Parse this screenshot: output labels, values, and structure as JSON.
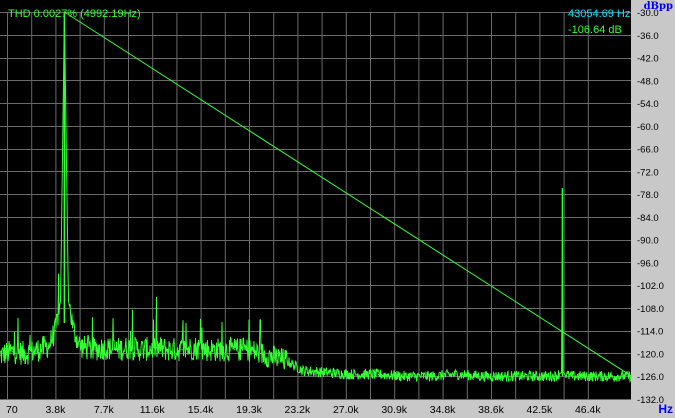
{
  "readouts": {
    "thd": "THD 0.0027% (4992.19Hz)",
    "cursor_frequency": "43054.69 Hz",
    "cursor_level": "-106.64 dB"
  },
  "colors": {
    "background": "#000000",
    "grid": "#6a6a6a",
    "trace": "#33ff33",
    "panel": "#c8c8c8",
    "unit_label": "#0000ff"
  },
  "chart_data": {
    "type": "line",
    "xlabel": "Hz",
    "ylabel": "dBpp",
    "x_tick_labels": [
      "70",
      "3.8k",
      "7.7k",
      "11.6k",
      "15.4k",
      "19.3k",
      "23.2k",
      "27.0k",
      "30.9k",
      "34.8k",
      "38.6k",
      "42.5k",
      "46.4k"
    ],
    "y_tick_labels": [
      "-30.0",
      "-36.0",
      "-42.0",
      "-48.0",
      "-54.0",
      "-60.0",
      "-66.0",
      "-72.0",
      "-78.0",
      "-84.0",
      "-90.0",
      "-96.0",
      "-102.0",
      "-108.0",
      "-114.0",
      "-120.0",
      "-126.0",
      "-132.0"
    ],
    "xlim": [
      70,
      48300
    ],
    "ylim": [
      -132,
      -30
    ],
    "grid": true,
    "series": [
      {
        "color": "#33ff33",
        "x": [
          70,
          1000,
          2000,
          3000,
          3800,
          4300,
          4700,
          4992,
          5300,
          5700,
          6200,
          7000,
          8000,
          9000,
          10000,
          11000,
          12000,
          13000,
          14000,
          15000,
          16000,
          17000,
          18000,
          19000,
          20000,
          21000,
          22000,
          23200,
          25000,
          27000,
          29000,
          31000,
          33000,
          35000,
          37000,
          39000,
          41000,
          42500,
          43000,
          43055,
          43100,
          43600,
          44500,
          45500,
          46400,
          47500,
          48300
        ],
        "y": [
          -120.5,
          -119.5,
          -120,
          -119,
          -118,
          -114,
          -106,
          -30,
          -106,
          -114,
          -118,
          -119,
          -118.5,
          -119,
          -118.5,
          -119,
          -118.5,
          -119,
          -119,
          -118.5,
          -119,
          -119,
          -119,
          -119,
          -120,
          -121,
          -122,
          -124.5,
          -125,
          -125.5,
          -125.5,
          -126,
          -126,
          -125.5,
          -126,
          -126,
          -126,
          -126,
          -125,
          -76.5,
          -125,
          -126,
          -126,
          -126,
          -126,
          -126,
          -126
        ]
      }
    ],
    "annotations": [
      "THD 0.0027% (4992.19Hz)",
      "43054.69 Hz",
      "-106.64 dB"
    ]
  }
}
